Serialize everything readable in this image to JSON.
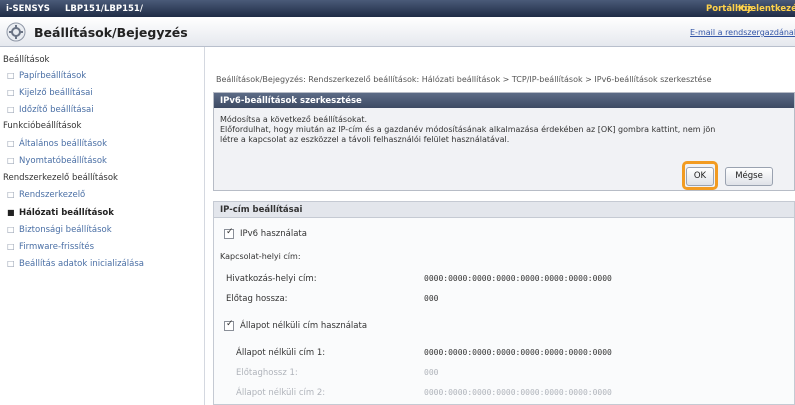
{
  "topbar": {
    "brand": "i-SENSYS",
    "model": "LBP151/LBP151/",
    "portal": "Portálhoz",
    "logout": "Kijelentkezés"
  },
  "header": {
    "title": "Beállítások/Bejegyzés",
    "email": "E-mail a rendszergazdának"
  },
  "sidebar": {
    "groups": [
      {
        "label": "Beállítások",
        "items": [
          "Papírbeállítások",
          "Kijelző beállításai",
          "Időzítő beállításai"
        ]
      },
      {
        "label": "Funkcióbeállítások",
        "items": [
          "Általános beállítások",
          "Nyomtatóbeállítások"
        ]
      },
      {
        "label": "Rendszerkezelő beállítások",
        "items": [
          "Rendszerkezelő",
          "Hálózati beállítások",
          "Biztonsági beállítások",
          "Firmware-frissítés",
          "Beállítás adatok inicializálása"
        ]
      }
    ]
  },
  "breadcrumb": "Beállítások/Bejegyzés: Rendszerkezelő beállítások: Hálózati beállítások > TCP/IP-beállítások > IPv6-beállítások szerkesztése",
  "dialog": {
    "title": "IPv6-beállítások szerkesztése",
    "line1": "Módosítsa a következő beállításokat.",
    "line2": "Előfordulhat, hogy miután az IP-cím és a gazdanév módosításának alkalmazása érdekében az [OK] gombra kattint, nem jön",
    "line3": "létre a kapcsolat az eszközzel a távoli felhasználói felület használatával.",
    "ok": "OK",
    "cancel": "Mégse"
  },
  "section": {
    "title": "IP-cím beállításai",
    "use_ipv6": "IPv6 használata",
    "link_local_label": "Kapcsolat-helyi cím:",
    "router_addr_label": "Hivatkozás-helyi cím:",
    "router_addr_value": "0000:0000:0000:0000:0000:0000:0000:0000",
    "prefix_label": "Előtag hossza:",
    "prefix_value": "000",
    "stateless_label": "Állapot nélküli cím használata",
    "stateless1_label": "Állapot nélküli cím 1:",
    "stateless1_value": "0000:0000:0000:0000:0000:0000:0000:0000",
    "prefix1_label": "Előtaghossz 1:",
    "prefix1_value": "000",
    "stateless2_label": "Állapot nélküli cím 2:",
    "stateless2_value": "0000:0000:0000:0000:0000:0000:0000:0000"
  }
}
